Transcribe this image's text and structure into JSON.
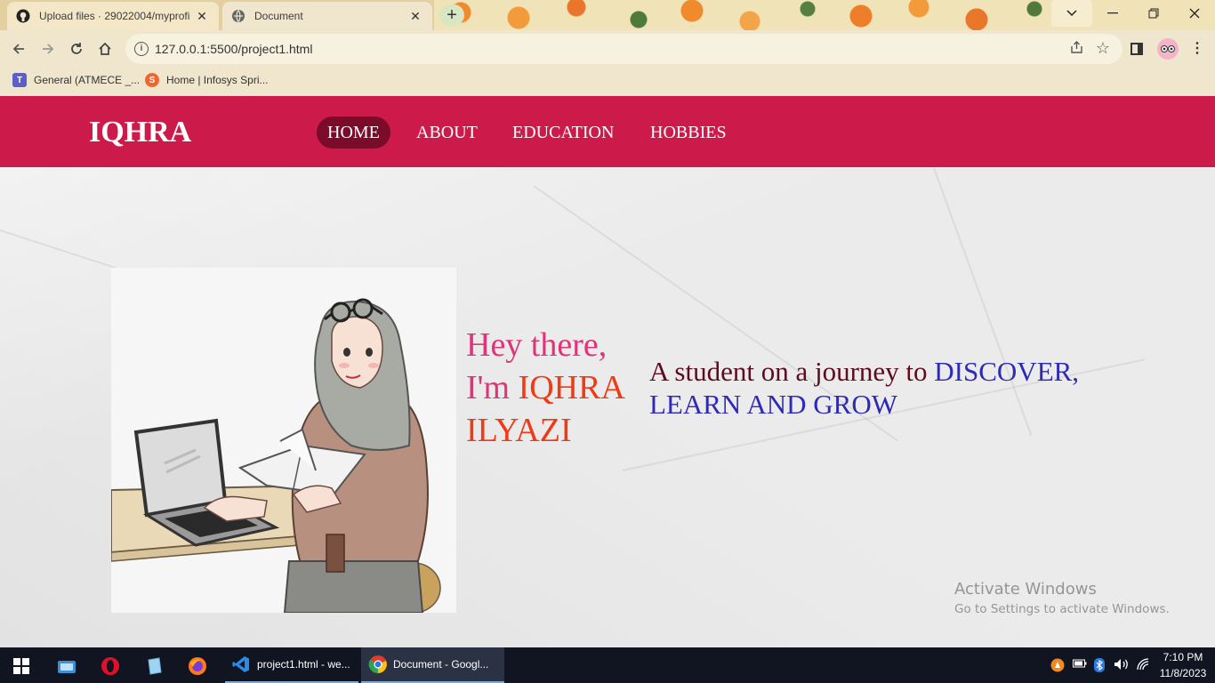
{
  "browser": {
    "tabs": [
      {
        "title": "Upload files · 29022004/myprofi",
        "close": "✕"
      },
      {
        "title": "Document",
        "close": "✕"
      }
    ],
    "new_tab": "+",
    "url": "127.0.0.1:5500/project1.html",
    "bookmarks": [
      {
        "label": "General (ATMECE _..."
      },
      {
        "label": "Home | Infosys Spri..."
      }
    ]
  },
  "site": {
    "logo": "IQHRA",
    "nav": [
      {
        "label": "HOME",
        "active": true
      },
      {
        "label": "ABOUT"
      },
      {
        "label": "EDUCATION"
      },
      {
        "label": "HOBBIES"
      }
    ],
    "greeting": {
      "line1": "Hey there,",
      "line2_prefix": "I'm ",
      "name_first": "IQHRA",
      "name_last": "ILYAZI"
    },
    "tagline": {
      "prefix": "A student on a journey to ",
      "highlight": "DISCOVER, LEARN AND GROW"
    },
    "colors": {
      "navbar": "#cc1a4a",
      "active_nav": "#7a0b2a",
      "greeting_pink": "#e0337a",
      "name_orange": "#ef3a16",
      "tagline_maroon": "#5e0b20",
      "tagline_blue": "#2e2ab6"
    }
  },
  "watermark": {
    "line1": "Activate Windows",
    "line2": "Go to Settings to activate Windows."
  },
  "taskbar": {
    "apps": [
      {
        "label": "project1.html - we...",
        "icon": "vscode-icon"
      },
      {
        "label": "Document - Googl...",
        "icon": "chrome-icon"
      }
    ],
    "time": "7:10 PM",
    "date": "11/8/2023"
  }
}
